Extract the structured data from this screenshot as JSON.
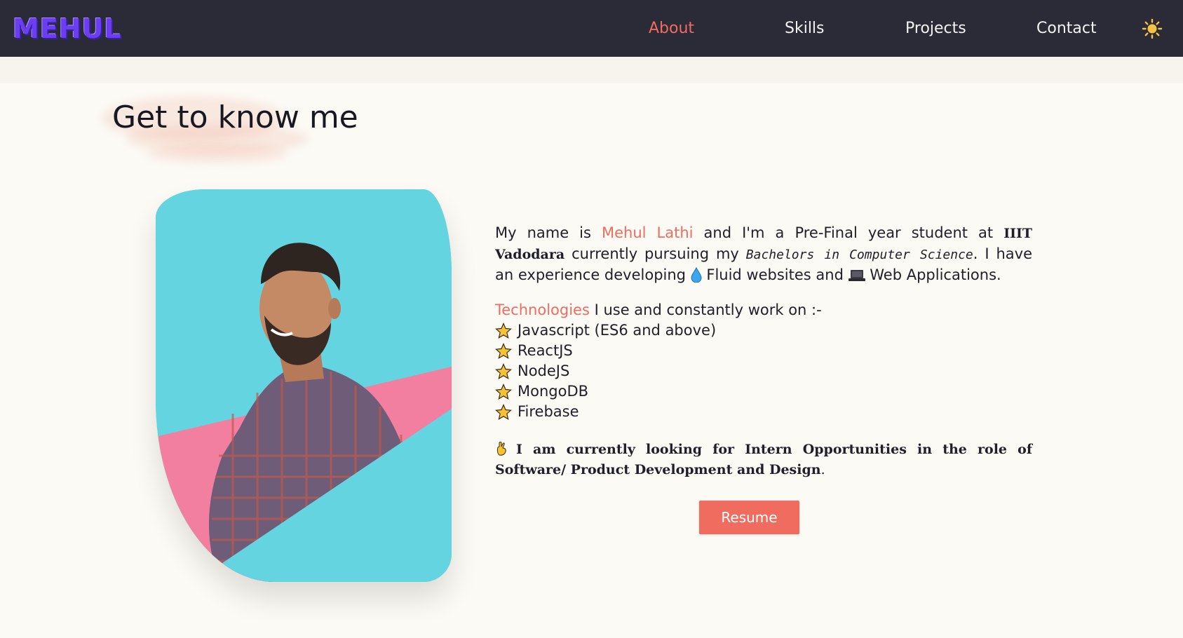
{
  "nav": {
    "logo": "MEHUL",
    "links": [
      "About",
      "Skills",
      "Projects",
      "Contact"
    ],
    "active": "About",
    "theme_icon": "sun-icon"
  },
  "about": {
    "heading": "Get to know me",
    "intro": {
      "t1": "My name is ",
      "name": "Mehul Lathi",
      "t2": " and I'm a Pre-Final year student at ",
      "college": "IIIT Vadodara",
      "t3": " currently pursuing my ",
      "degree": "Bachelors in Computer Science",
      "t4": ". I have an experience developing ",
      "t5": " Fluid websites and ",
      "t6": " Web Applications."
    },
    "tech_heading": "Technologies",
    "tech_intro": " I use and constantly work on :-",
    "technologies": [
      "Javascript (ES6 and above)",
      "ReactJS",
      "NodeJS",
      "MongoDB",
      "Firebase"
    ],
    "looking_bold": "I am currently looking for Intern Opportunities in the role of Software/ Product Development and Design",
    "looking_end": ".",
    "resume_label": "Resume"
  },
  "colors": {
    "accent": "#ef6c5f",
    "navbar": "#2b2b38",
    "background": "#fbfaf4",
    "card_cyan": "#64d4e0",
    "card_pink": "#f37fa0",
    "logo": "#6b3ff0"
  }
}
